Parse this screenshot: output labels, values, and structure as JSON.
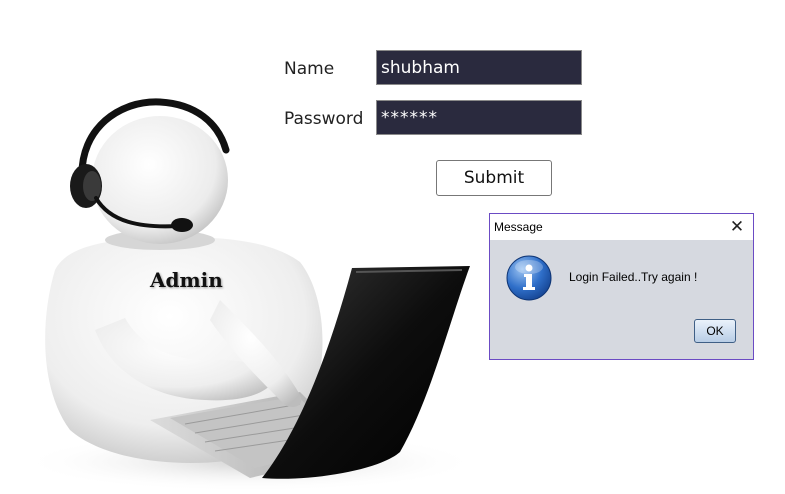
{
  "login_form": {
    "name_label": "Name",
    "name_value": "shubham",
    "password_label": "Password",
    "password_value": "******",
    "submit_label": "Submit"
  },
  "illustration": {
    "admin_label": "Admin"
  },
  "message_dialog": {
    "title": "Message",
    "close_glyph": "✕",
    "icon": "info-icon",
    "message": "Login Failed..Try again !",
    "ok_label": "OK"
  },
  "colors": {
    "input_background": "#2a2a3e",
    "dialog_border": "#6b4bc4",
    "dialog_body": "#d6d9e0"
  }
}
